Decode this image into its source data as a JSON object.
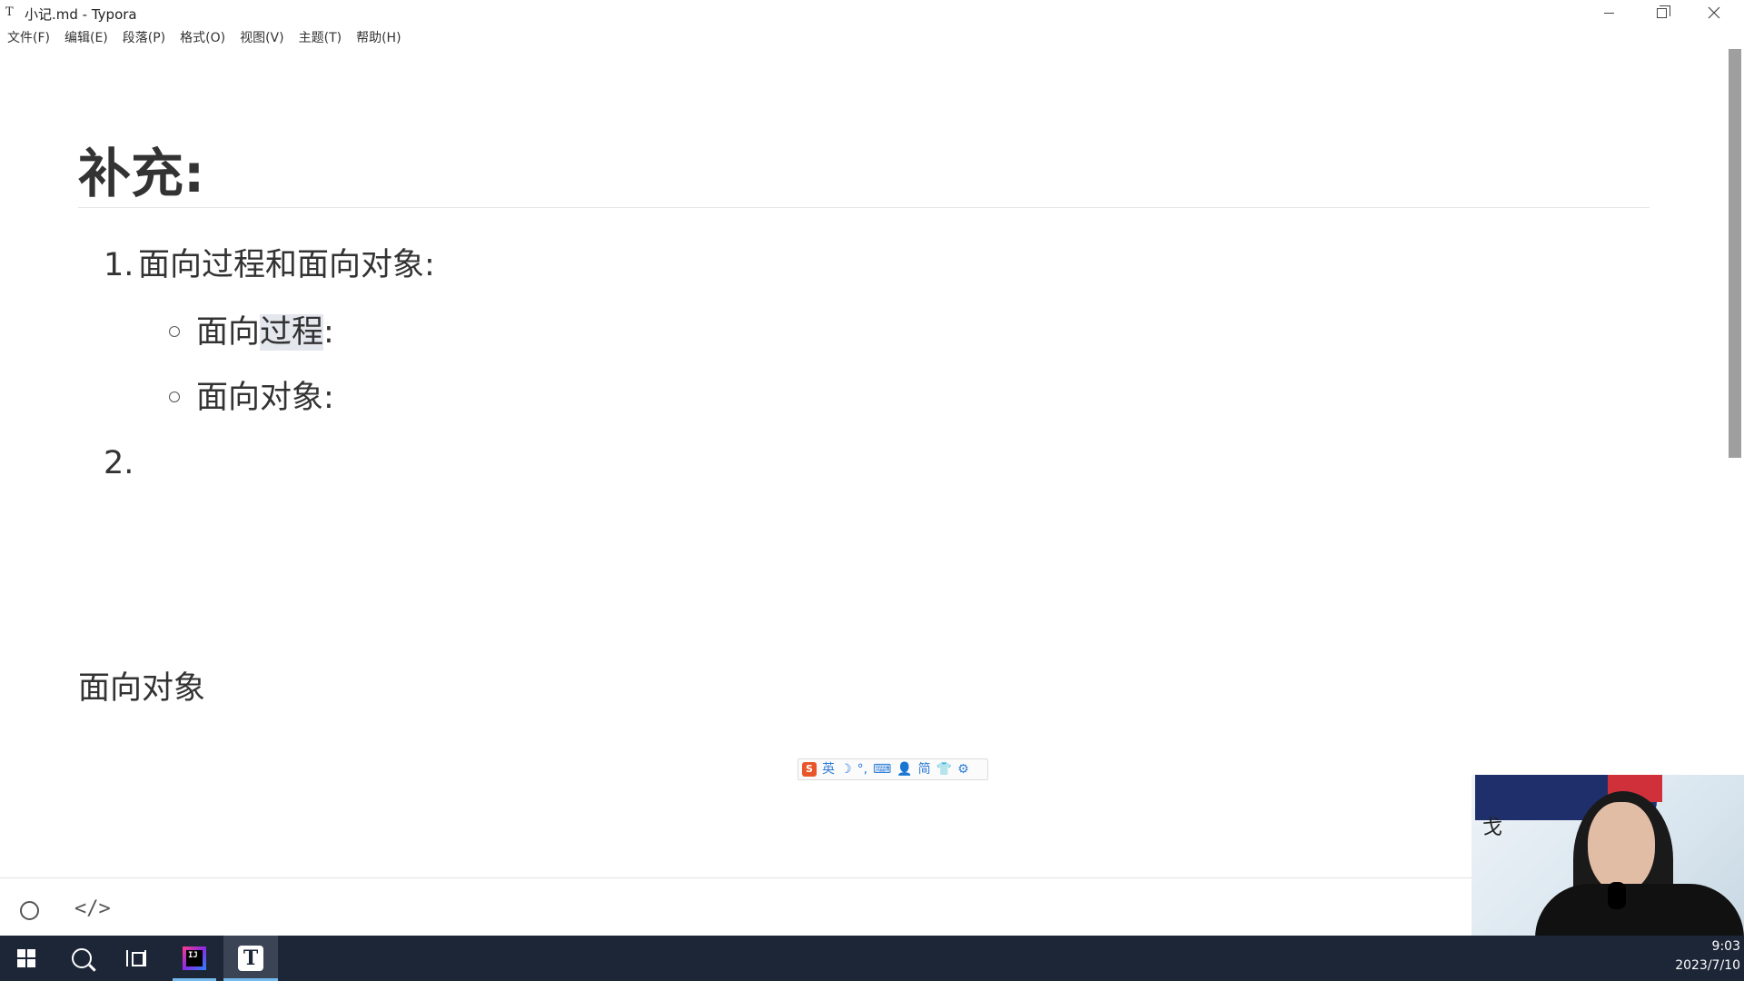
{
  "window": {
    "icon_letter": "T",
    "title": "小记.md - Typora"
  },
  "menu": [
    "文件(F)",
    "编辑(E)",
    "段落(P)",
    "格式(O)",
    "视图(V)",
    "主题(T)",
    "帮助(H)"
  ],
  "document": {
    "heading": "补充:",
    "list": [
      {
        "number": "1.",
        "text": "面向过程和面向对象:",
        "subitems": [
          {
            "prefix": "面向",
            "selected": "过程",
            "suffix": ":"
          },
          {
            "prefix": "面向对象:",
            "selected": "",
            "suffix": ""
          }
        ]
      },
      {
        "number": "2.",
        "text": ""
      }
    ],
    "paragraph": "面向对象"
  },
  "ime_toolbar": {
    "logo": "S",
    "items": [
      "英",
      "☽",
      "°,",
      "⌨",
      "👤",
      "简",
      "👕",
      "⚙"
    ]
  },
  "statusbar": {
    "source_mode_label": "</>"
  },
  "webcam": {
    "sign_char": "戈"
  },
  "taskbar": {
    "idea_label": "IJ",
    "typora_label": "T",
    "time": "9:03",
    "date": "2023/7/10"
  },
  "colors": {
    "taskbar_bg": "#1c2637",
    "selection": "#e4e7ee",
    "ime_blue": "#2f7ed8",
    "ime_logo": "#e8562a"
  }
}
